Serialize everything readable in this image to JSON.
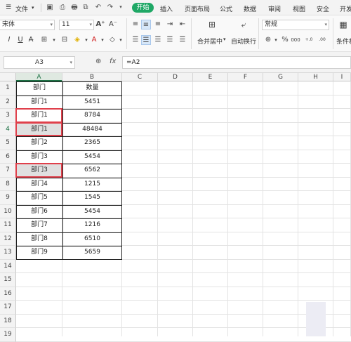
{
  "menubar": {
    "file_label": "文件",
    "tabs": [
      "开始",
      "插入",
      "页面布局",
      "公式",
      "数据",
      "审阅",
      "视图",
      "安全",
      "开发"
    ],
    "active_tab": "开始"
  },
  "ribbon": {
    "font_name": "宋体",
    "font_size": "11",
    "number_format": "常规",
    "merge_label": "合并居中",
    "wrap_label": "自动换行",
    "conditional_label": "条件格"
  },
  "formula_bar": {
    "name_box": "A3",
    "fx_label": "fx",
    "formula": "=A2"
  },
  "grid": {
    "columns": [
      "A",
      "B",
      "C",
      "D",
      "E",
      "F",
      "G",
      "H",
      "I"
    ],
    "active_column": "A",
    "rows": [
      "1",
      "2",
      "3",
      "4",
      "5",
      "6",
      "7",
      "8",
      "9",
      "10",
      "11",
      "12",
      "13",
      "14",
      "15",
      "16",
      "17",
      "18",
      "19"
    ],
    "active_row": "4",
    "table": [
      [
        "部门",
        "数量"
      ],
      [
        "部门1",
        "5451"
      ],
      [
        "部门1",
        "8784"
      ],
      [
        "部门1",
        "48484"
      ],
      [
        "部门2",
        "2365"
      ],
      [
        "部门3",
        "5454"
      ],
      [
        "部门3",
        "6562"
      ],
      [
        "部门4",
        "1215"
      ],
      [
        "部门5",
        "1545"
      ],
      [
        "部门6",
        "5454"
      ],
      [
        "部门7",
        "1216"
      ],
      [
        "部门8",
        "6510"
      ],
      [
        "部门9",
        "5659"
      ]
    ],
    "highlighted_rows": [
      "3",
      "4",
      "7"
    ]
  },
  "colors": {
    "accent_green": "#1fa866",
    "highlight_red": "#e0404b"
  }
}
